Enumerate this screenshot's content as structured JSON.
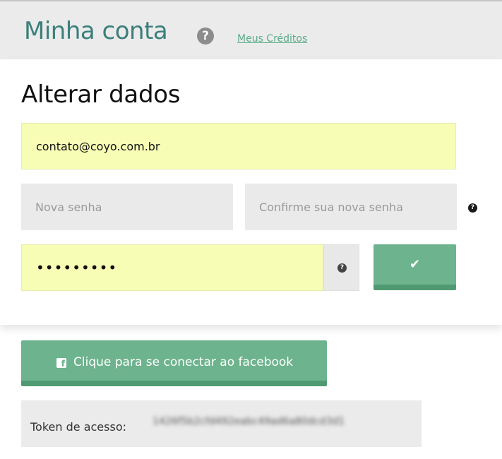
{
  "header": {
    "title": "Minha conta",
    "help_icon": "question-circle-icon",
    "credits_link": "Meus Créditos"
  },
  "form": {
    "section_title": "Alterar dados",
    "email_value": "contato@coyo.com.br",
    "new_password_placeholder": "Nova senha",
    "confirm_password_placeholder": "Confirme sua nova senha",
    "current_password_value": "•••••••••",
    "help_glyph": "?",
    "save_button": {
      "icon": "check-icon",
      "glyph": "✔"
    }
  },
  "facebook": {
    "icon": "facebook-icon",
    "icon_glyph": "f",
    "label": "Clique para se conectar ao facebook"
  },
  "token": {
    "label": "Token de acesso:",
    "value": "1426f5b2cfd492eabc49ad6a80dcd3d1"
  },
  "colors": {
    "accent_green": "#6db38d",
    "title_teal": "#3b7f7a",
    "input_yellow": "#f8fdb5",
    "input_gray": "#eaeaea"
  }
}
